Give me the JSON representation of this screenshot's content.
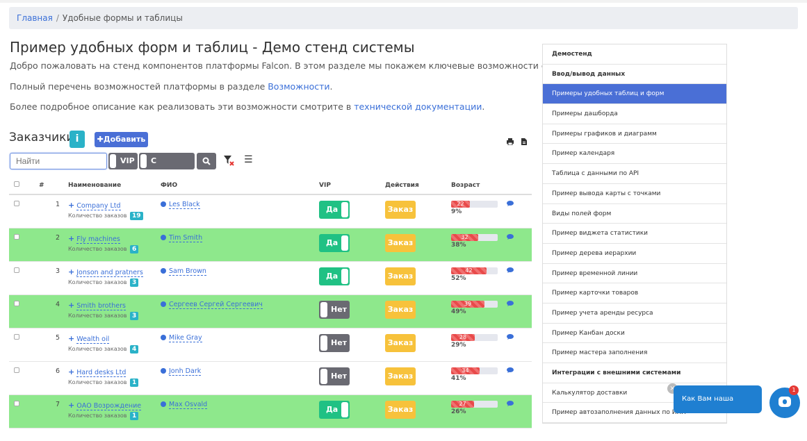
{
  "breadcrumb": {
    "home": "Главная",
    "sep": "/",
    "current": "Удобные формы и таблицы"
  },
  "title": "Пример удобных форм и таблиц - Демо стенд системы",
  "intro": {
    "p1": "Добро пожаловать на стенд компонентов платформы Falcon. В этом разделе мы покажем ключевые возможности системы.",
    "p2_prefix": "Полный перечень возможностей платформы в разделе ",
    "p2_link": "Возможности",
    "p2_suffix": ".",
    "p3_prefix": "Более подробное описание как реализовать эти возможности смотрите в ",
    "p3_link": "технической документации",
    "p3_suffix": "."
  },
  "customers": {
    "title": "Заказчики",
    "info": "i",
    "add": "Добавить",
    "search_placeholder": "Найти",
    "vip_toggle": "VIP",
    "orders_toggle": "С заказами",
    "columns": {
      "num": "#",
      "name": "Наименование",
      "fio": "ФИО",
      "vip": "VIP",
      "actions": "Действия",
      "age": "Возраст"
    },
    "orders_label": "Количество заказов",
    "order_btn": "Заказ",
    "vip_yes": "Да",
    "vip_no": "Нет",
    "rows": [
      {
        "num": "1",
        "name": "Company Ltd",
        "orders": "19",
        "fio": "Les Black",
        "vip": "Да",
        "age": "22",
        "pct": "9%"
      },
      {
        "num": "2",
        "name": "Fly machines",
        "orders": "6",
        "fio": "Tim Smith",
        "vip": "Да",
        "age": "32",
        "pct": "38%"
      },
      {
        "num": "3",
        "name": "Jonson and pratners",
        "orders": "3",
        "fio": "Sam Brown",
        "vip": "Да",
        "age": "42",
        "pct": "52%"
      },
      {
        "num": "4",
        "name": "Smith brothers",
        "orders": "3",
        "fio": "Сергеев Сергей Сергеевич",
        "vip": "Нет",
        "age": "39",
        "pct": "49%"
      },
      {
        "num": "5",
        "name": "Wealth oil",
        "orders": "4",
        "fio": "Mike Gray",
        "vip": "Нет",
        "age": "28",
        "pct": "29%"
      },
      {
        "num": "6",
        "name": "Hard desks Ltd",
        "orders": "1",
        "fio": "Jonh Dark",
        "vip": "Нет",
        "age": "34",
        "pct": "41%"
      },
      {
        "num": "7",
        "name": "ОАО Возрождение",
        "orders": "1",
        "fio": "Max Osvald",
        "vip": "Да",
        "age": "27",
        "pct": "26%"
      }
    ]
  },
  "sidebar": {
    "items": [
      {
        "label": "Демостенд",
        "kind": "head"
      },
      {
        "label": "Ввод/вывод данных",
        "kind": "head"
      },
      {
        "label": "Примеры удобных таблиц и форм",
        "kind": "active"
      },
      {
        "label": "Примеры дашборда",
        "kind": "item"
      },
      {
        "label": "Примеры графиков и диаграмм",
        "kind": "item"
      },
      {
        "label": "Пример календаря",
        "kind": "item"
      },
      {
        "label": "Таблица с данными по API",
        "kind": "item"
      },
      {
        "label": "Пример вывода карты с точками",
        "kind": "item"
      },
      {
        "label": "Виды полей форм",
        "kind": "item"
      },
      {
        "label": "Пример виджета статистики",
        "kind": "item"
      },
      {
        "label": "Пример дерева иерархии",
        "kind": "item"
      },
      {
        "label": "Пример временной линии",
        "kind": "item"
      },
      {
        "label": "Пример карточки товаров",
        "kind": "item"
      },
      {
        "label": "Пример учета аренды ресурса",
        "kind": "item"
      },
      {
        "label": "Пример Канбан доски",
        "kind": "item"
      },
      {
        "label": "Пример мастера заполнения",
        "kind": "item"
      },
      {
        "label": "Интеграции с внешними системами",
        "kind": "head"
      },
      {
        "label": "Калькулятор доставки",
        "kind": "item"
      },
      {
        "label": "Пример автозаполнения данных по ИНН",
        "kind": "item"
      }
    ]
  },
  "chat": {
    "message": "Как Вам наша система?",
    "badge": "1",
    "close": "×"
  },
  "colors": {
    "accent": "#4a6fd6",
    "info": "#2ab2c8",
    "green_row": "#8ee88c",
    "vip_yes": "#20c184",
    "vip_no": "#6a6a72",
    "order": "#f7c23b"
  }
}
